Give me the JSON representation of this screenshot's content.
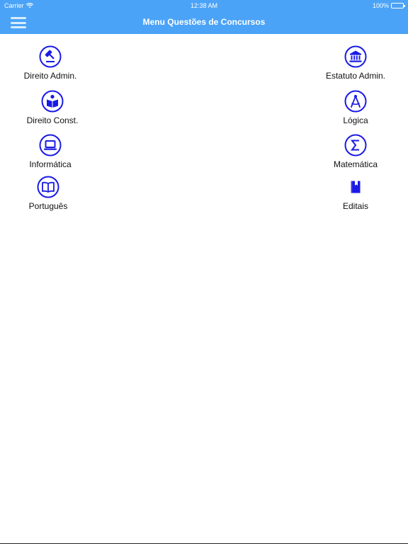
{
  "status_bar": {
    "carrier": "Carrier",
    "time": "12:38 AM",
    "battery": "100%",
    "battery_level": 1.0
  },
  "nav": {
    "title": "Menu Questões de Concursos",
    "menu_icon": "hamburger-icon"
  },
  "colors": {
    "header": "#4ba3f7",
    "icon": "#1a1ae6",
    "text": "#111111"
  },
  "menu": {
    "left": [
      {
        "label": "Direito Admin.",
        "icon": "gavel-icon"
      },
      {
        "label": "Direito Const.",
        "icon": "reader-icon"
      },
      {
        "label": "Informática",
        "icon": "laptop-icon"
      },
      {
        "label": "Português",
        "icon": "book-open-icon"
      }
    ],
    "right": [
      {
        "label": "Estatuto Admin.",
        "icon": "institution-icon"
      },
      {
        "label": "Lógica",
        "icon": "compass-icon"
      },
      {
        "label": "Matemática",
        "icon": "sigma-icon"
      },
      {
        "label": "Editais",
        "icon": "bookmark-book-icon"
      }
    ]
  }
}
